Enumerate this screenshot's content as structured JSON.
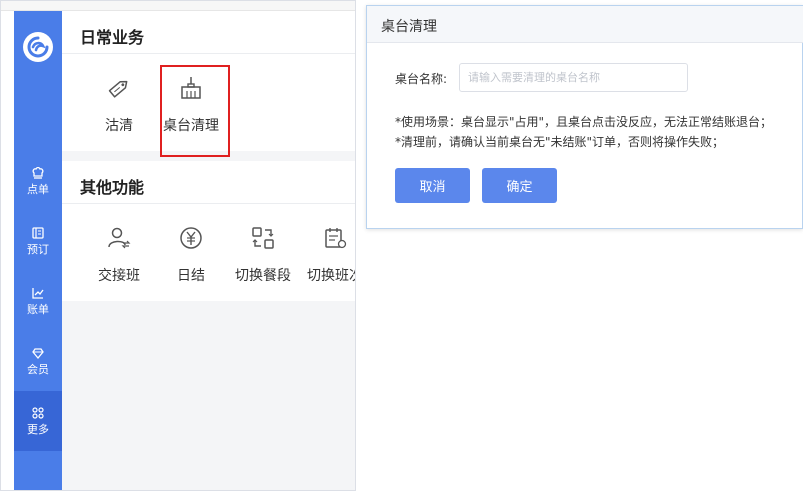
{
  "colors": {
    "sidebar": "#4a7de8",
    "sidebar_active": "#3766d6",
    "button": "#5b87ec",
    "highlight": "#e02020",
    "icon": "#555555"
  },
  "sidebar": {
    "logo_icon": "brand-logo-icon",
    "items": [
      {
        "label": "点单",
        "icon": "chef-hat-icon"
      },
      {
        "label": "预订",
        "icon": "book-icon"
      },
      {
        "label": "账单",
        "icon": "chart-icon"
      },
      {
        "label": "会员",
        "icon": "gem-icon"
      },
      {
        "label": "更多",
        "icon": "grid-icon",
        "active": true
      }
    ]
  },
  "daily": {
    "title": "日常业务",
    "tiles": [
      {
        "label": "沽清",
        "icon": "price-tag-icon"
      },
      {
        "label": "桌台清理",
        "icon": "broom-icon",
        "highlighted": true
      }
    ]
  },
  "other": {
    "title": "其他功能",
    "tiles": [
      {
        "label": "交接班",
        "icon": "user-swap-icon"
      },
      {
        "label": "日结",
        "icon": "yen-circle-icon"
      },
      {
        "label": "切换餐段",
        "icon": "switch-icon"
      },
      {
        "label": "切换班次",
        "icon": "calendar-switch-icon"
      }
    ]
  },
  "dialog": {
    "title": "桌台清理",
    "field_label": "桌台名称:",
    "field_placeholder": "请输入需要清理的桌台名称",
    "field_value": "",
    "note1": "*使用场景：桌台显示\"占用\"，且桌台点击没反应，无法正常结账退台；",
    "note2": "*清理前，请确认当前桌台无\"未结账\"订单，否则将操作失败；",
    "cancel_label": "取消",
    "confirm_label": "确定"
  }
}
